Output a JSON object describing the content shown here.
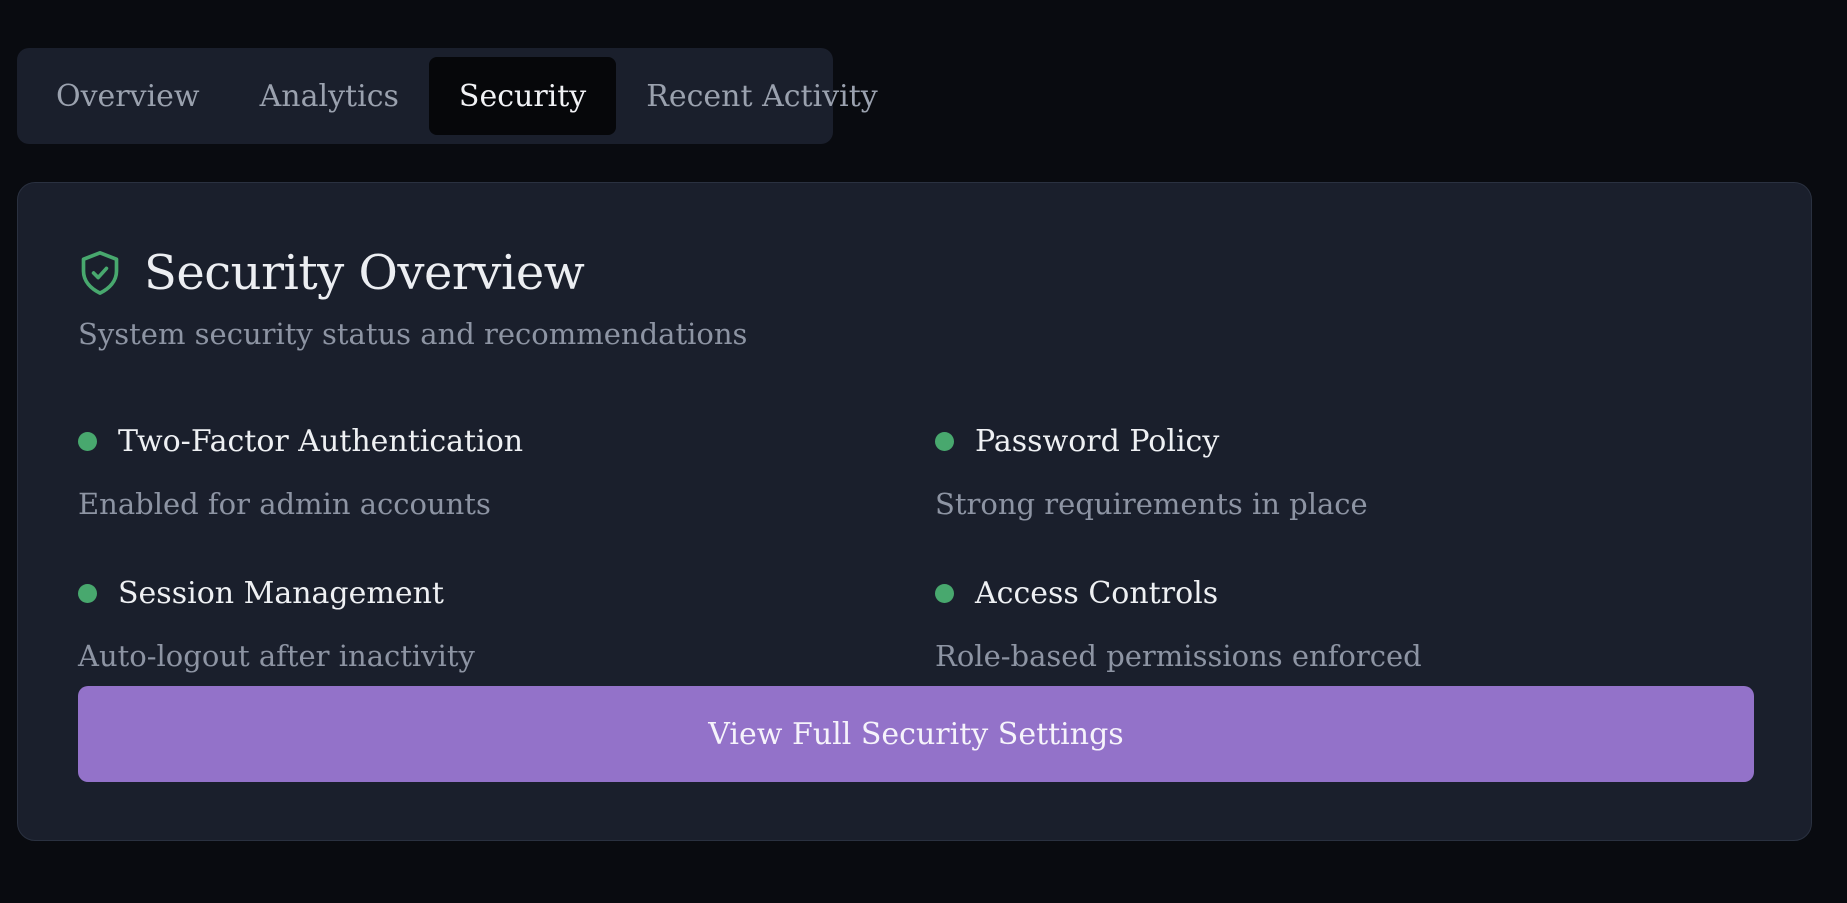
{
  "tabs": [
    {
      "label": "Overview"
    },
    {
      "label": "Analytics"
    },
    {
      "label": "Security"
    },
    {
      "label": "Recent Activity"
    }
  ],
  "active_tab": "Security",
  "card": {
    "title": "Security Overview",
    "subtitle": "System security status and recommendations",
    "icon": "shield-check-icon",
    "status_color": "#48a86e",
    "items": [
      {
        "title": "Two-Factor Authentication",
        "description": "Enabled for admin accounts"
      },
      {
        "title": "Password Policy",
        "description": "Strong requirements in place"
      },
      {
        "title": "Session Management",
        "description": "Auto-logout after inactivity"
      },
      {
        "title": "Access Controls",
        "description": "Role-based permissions enforced"
      }
    ],
    "button_label": "View Full Security Settings",
    "button_color": "#9372c9"
  }
}
